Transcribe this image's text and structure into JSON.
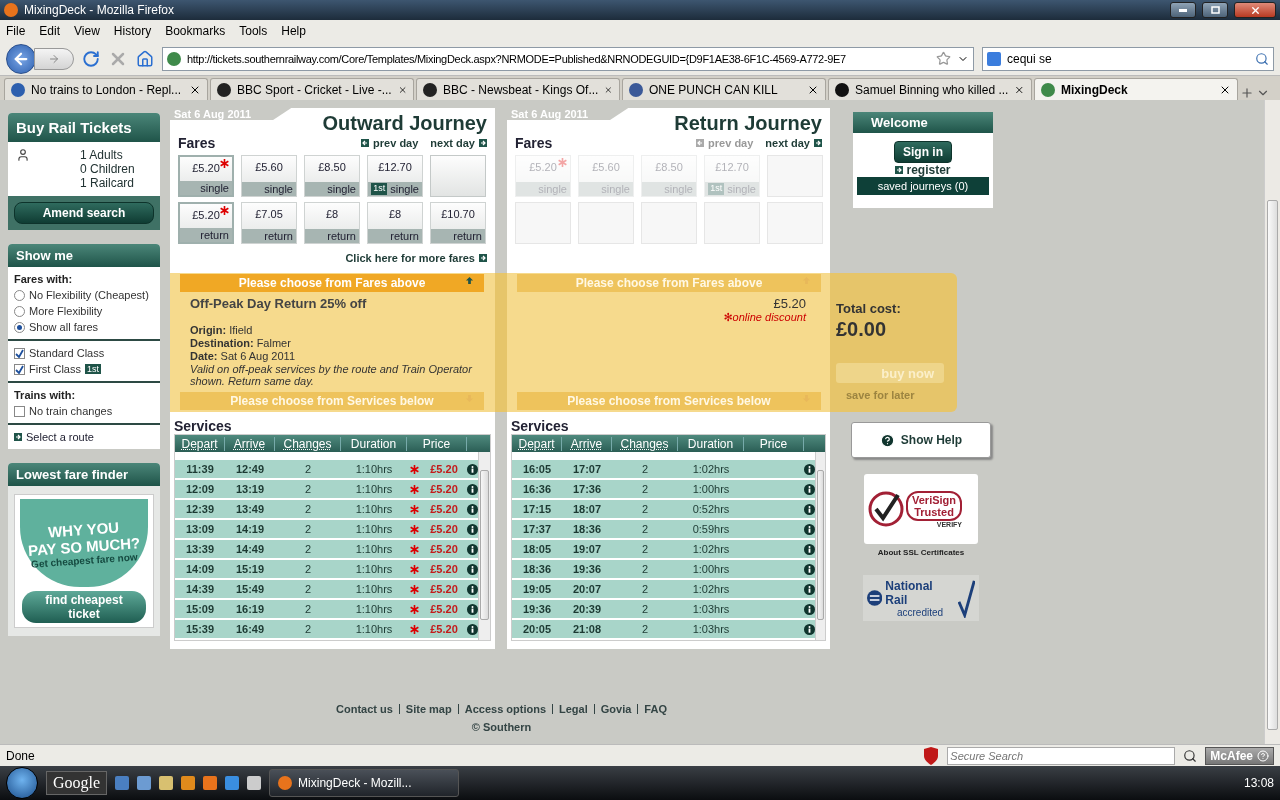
{
  "browser": {
    "title": "MixingDeck - Mozilla Firefox",
    "menu": [
      "File",
      "Edit",
      "View",
      "History",
      "Bookmarks",
      "Tools",
      "Help"
    ],
    "url": "http://tickets.southernrailway.com/Core/Templates/MixingDeck.aspx?NRMODE=Published&NRNODEGUID={D9F1AE38-6F1C-4569-A772-9E7",
    "search": "cequi se",
    "tabs": [
      {
        "label": "No trains to London - Repl...",
        "selected": false
      },
      {
        "label": "BBC Sport - Cricket - Live -...",
        "selected": false
      },
      {
        "label": "BBC - Newsbeat - Kings Of...",
        "selected": false
      },
      {
        "label": "ONE PUNCH CAN KILL",
        "selected": false
      },
      {
        "label": "Samuel Binning who killed ...",
        "selected": false
      },
      {
        "label": "MixingDeck",
        "selected": true
      }
    ],
    "status": "Done",
    "secure_search_placeholder": "Secure Search",
    "toolbar_brand": "McAfee"
  },
  "sidebar": {
    "buy": {
      "title": "Buy Rail Tickets",
      "passengers": [
        "1 Adults",
        "0 Children",
        "1 Railcard"
      ],
      "button": "Amend search"
    },
    "show_me": {
      "title": "Show me",
      "fares_label": "Fares with:",
      "fare_options": [
        {
          "label": "No Flexibility (Cheapest)",
          "selected": false
        },
        {
          "label": "More Flexibility",
          "selected": false
        },
        {
          "label": "Show all fares",
          "selected": true
        }
      ],
      "classes": [
        {
          "label": "Standard Class",
          "checked": true
        },
        {
          "label": "First Class",
          "checked": true,
          "badge": "1st"
        }
      ],
      "trains_label": "Trains with:",
      "train_options": [
        {
          "label": "No train changes",
          "checked": false
        }
      ],
      "route_link": "Select a route"
    },
    "finder": {
      "title": "Lowest fare finder",
      "ad_lines": [
        "WHY YOU",
        "PAY SO MUCH?",
        "Get cheapest fare now"
      ],
      "button": "find cheapest ticket"
    }
  },
  "journeys": [
    {
      "date": "Sat 6 Aug 2011",
      "title": "Outward Journey",
      "fares_label": "Fares",
      "nav": [
        {
          "label": "prev day",
          "disabled": false
        },
        {
          "label": "next day",
          "disabled": false
        }
      ],
      "fares": [
        {
          "kind": "fare",
          "price": "£5.20",
          "type": "single",
          "discount": true,
          "selected": true,
          "disabled": false
        },
        {
          "kind": "fare",
          "price": "£5.60",
          "type": "single",
          "discount": false,
          "selected": false,
          "disabled": false
        },
        {
          "kind": "fare",
          "price": "£8.50",
          "type": "single",
          "discount": false,
          "selected": false,
          "disabled": false
        },
        {
          "kind": "fare",
          "price": "£12.70",
          "type": "single",
          "badge": "1st",
          "discount": false,
          "selected": false,
          "disabled": false
        },
        {
          "kind": "empty",
          "disabled": false
        },
        {
          "kind": "fare",
          "price": "£5.20",
          "type": "return",
          "discount": true,
          "selected": true,
          "disabled": false
        },
        {
          "kind": "fare",
          "price": "£7.05",
          "type": "return",
          "discount": false,
          "selected": false,
          "disabled": false
        },
        {
          "kind": "fare",
          "price": "£8",
          "type": "return",
          "discount": false,
          "selected": false,
          "disabled": false
        },
        {
          "kind": "fare",
          "price": "£8",
          "type": "return",
          "discount": false,
          "selected": false,
          "disabled": false
        },
        {
          "kind": "fare",
          "price": "£10.70",
          "type": "return",
          "discount": false,
          "selected": false,
          "disabled": false
        }
      ],
      "more_fares": "Click here for more fares",
      "band": {
        "top": {
          "label": "Please choose from Fares above",
          "active": true
        },
        "fare_name": "Off-Peak Day Return 25% off",
        "details": [
          {
            "label": "Origin:",
            "value": "Ifield"
          },
          {
            "label": "Destination:",
            "value": "Falmer"
          },
          {
            "label": "Date:",
            "value": "Sat 6 Aug 2011"
          }
        ],
        "note": "Valid on off-peak services by the route and Train Operator shown. Return same day.",
        "bottom": {
          "label": "Please choose from Services below",
          "active": false
        }
      },
      "services": {
        "title": "Services",
        "columns": [
          "Depart",
          "Arrive",
          "Changes",
          "Duration",
          "Price"
        ],
        "rows": [
          {
            "depart": "11:39",
            "arrive": "12:49",
            "changes": "2",
            "duration": "1:10hrs",
            "price": "£5.20",
            "discount": true
          },
          {
            "depart": "12:09",
            "arrive": "13:19",
            "changes": "2",
            "duration": "1:10hrs",
            "price": "£5.20",
            "discount": true
          },
          {
            "depart": "12:39",
            "arrive": "13:49",
            "changes": "2",
            "duration": "1:10hrs",
            "price": "£5.20",
            "discount": true
          },
          {
            "depart": "13:09",
            "arrive": "14:19",
            "changes": "2",
            "duration": "1:10hrs",
            "price": "£5.20",
            "discount": true
          },
          {
            "depart": "13:39",
            "arrive": "14:49",
            "changes": "2",
            "duration": "1:10hrs",
            "price": "£5.20",
            "discount": true
          },
          {
            "depart": "14:09",
            "arrive": "15:19",
            "changes": "2",
            "duration": "1:10hrs",
            "price": "£5.20",
            "discount": true
          },
          {
            "depart": "14:39",
            "arrive": "15:49",
            "changes": "2",
            "duration": "1:10hrs",
            "price": "£5.20",
            "discount": true
          },
          {
            "depart": "15:09",
            "arrive": "16:19",
            "changes": "2",
            "duration": "1:10hrs",
            "price": "£5.20",
            "discount": true
          },
          {
            "depart": "15:39",
            "arrive": "16:49",
            "changes": "2",
            "duration": "1:10hrs",
            "price": "£5.20",
            "discount": true
          }
        ]
      }
    },
    {
      "date": "Sat 6 Aug 2011",
      "title": "Return Journey",
      "fares_label": "Fares",
      "nav": [
        {
          "label": "prev day",
          "disabled": true
        },
        {
          "label": "next day",
          "disabled": false
        }
      ],
      "fares": [
        {
          "kind": "fare",
          "price": "£5.20",
          "type": "single",
          "discount": true,
          "selected": false,
          "disabled": true
        },
        {
          "kind": "fare",
          "price": "£5.60",
          "type": "single",
          "discount": false,
          "selected": false,
          "disabled": true
        },
        {
          "kind": "fare",
          "price": "£8.50",
          "type": "single",
          "discount": false,
          "selected": false,
          "disabled": true
        },
        {
          "kind": "fare",
          "price": "£12.70",
          "type": "single",
          "badge": "1st",
          "discount": false,
          "selected": false,
          "disabled": true
        },
        {
          "kind": "empty",
          "disabled": true
        },
        {
          "kind": "empty",
          "disabled": true
        },
        {
          "kind": "empty",
          "disabled": true
        },
        {
          "kind": "empty",
          "disabled": true
        },
        {
          "kind": "empty",
          "disabled": true
        },
        {
          "kind": "empty",
          "disabled": true
        }
      ],
      "band": {
        "top": {
          "label": "Please choose from Fares above",
          "active": false
        },
        "price": "£5.20",
        "discount_note": "✻online discount",
        "bottom": {
          "label": "Please choose from Services below",
          "active": false
        }
      },
      "services": {
        "title": "Services",
        "columns": [
          "Depart",
          "Arrive",
          "Changes",
          "Duration",
          "Price"
        ],
        "rows": [
          {
            "depart": "16:05",
            "arrive": "17:07",
            "changes": "2",
            "duration": "1:02hrs",
            "discount": false
          },
          {
            "depart": "16:36",
            "arrive": "17:36",
            "changes": "2",
            "duration": "1:00hrs",
            "discount": false
          },
          {
            "depart": "17:15",
            "arrive": "18:07",
            "changes": "2",
            "duration": "0:52hrs",
            "discount": false
          },
          {
            "depart": "17:37",
            "arrive": "18:36",
            "changes": "2",
            "duration": "0:59hrs",
            "discount": false
          },
          {
            "depart": "18:05",
            "arrive": "19:07",
            "changes": "2",
            "duration": "1:02hrs",
            "discount": false
          },
          {
            "depart": "18:36",
            "arrive": "19:36",
            "changes": "2",
            "duration": "1:00hrs",
            "discount": false
          },
          {
            "depart": "19:05",
            "arrive": "20:07",
            "changes": "2",
            "duration": "1:02hrs",
            "discount": false
          },
          {
            "depart": "19:36",
            "arrive": "20:39",
            "changes": "2",
            "duration": "1:03hrs",
            "discount": false
          },
          {
            "depart": "20:05",
            "arrive": "21:08",
            "changes": "2",
            "duration": "1:03hrs",
            "discount": false
          }
        ]
      }
    }
  ],
  "total": {
    "label": "Total cost:",
    "amount": "£0.00",
    "buy": {
      "label": "buy now",
      "disabled": true
    },
    "save": {
      "label": "save for later",
      "disabled": true
    }
  },
  "welcome": {
    "title": "Welcome",
    "sign_in": "Sign in",
    "register": "register",
    "saved": "saved journeys (0)"
  },
  "help": "Show Help",
  "verisign": {
    "lines": [
      "VeriSign",
      "Trusted"
    ],
    "verify": "VERIFY",
    "caption": "About SSL Certificates"
  },
  "national_rail": {
    "name": "National Rail",
    "sub": "accredited"
  },
  "footer": {
    "links": [
      "Contact us",
      "Site map",
      "Access options",
      "Legal",
      "Govia",
      "FAQ"
    ],
    "copyright": "© Southern"
  },
  "taskbar": {
    "search": "Google",
    "window": "MixingDeck - Mozill...",
    "clock": "13:08"
  }
}
